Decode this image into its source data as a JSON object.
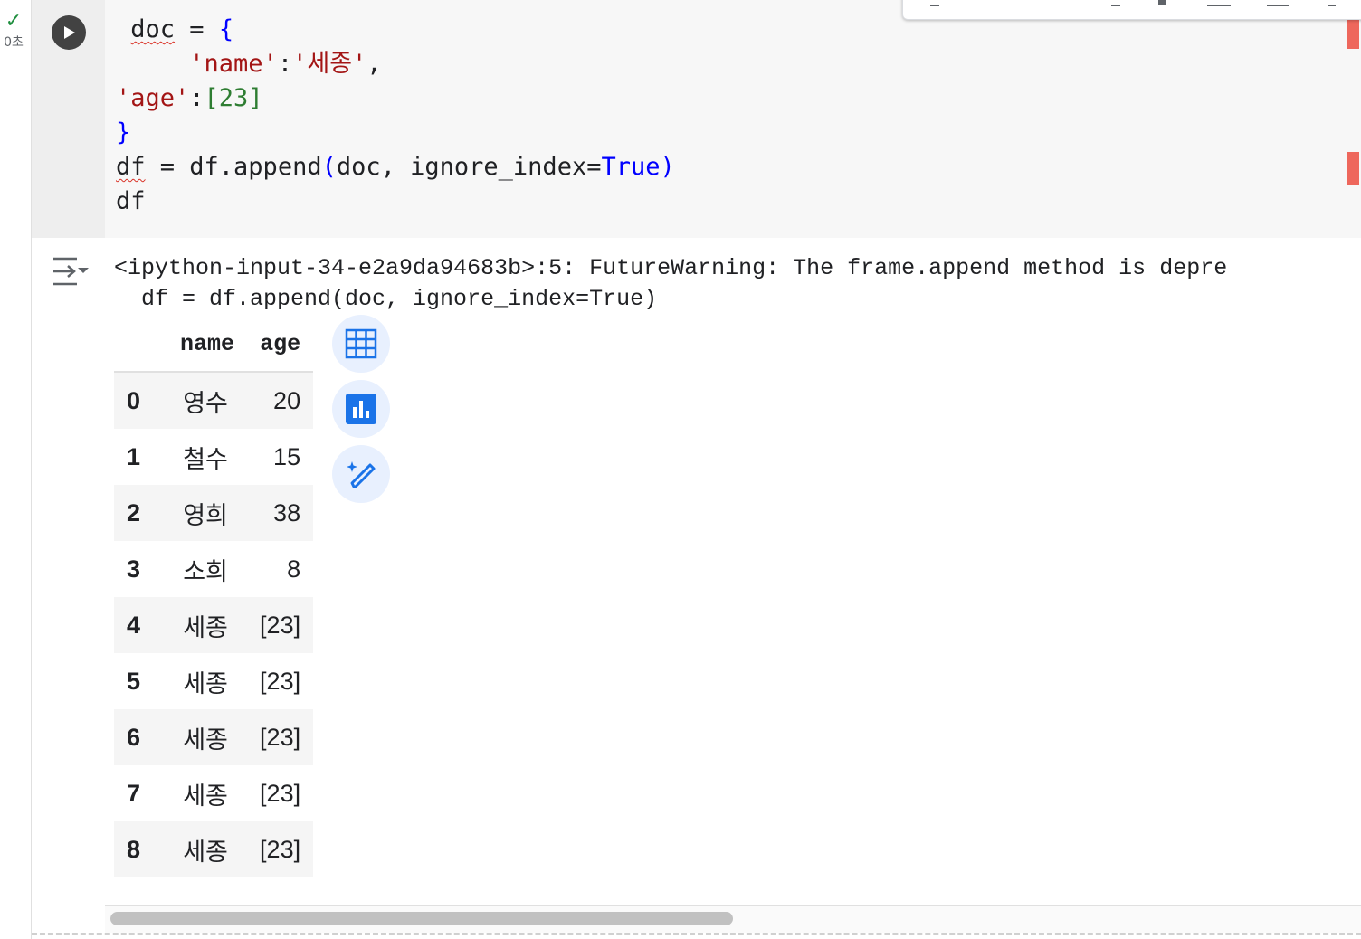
{
  "cell_status": {
    "check_symbol": "✓",
    "exec_time": "0초"
  },
  "code_lines": [
    [
      {
        "t": " ",
        "c": "plain"
      },
      {
        "t": "doc",
        "c": "squig"
      },
      {
        "t": " = ",
        "c": "plain"
      },
      {
        "t": "{",
        "c": "kw"
      }
    ],
    [
      {
        "t": "     ",
        "c": "plain"
      },
      {
        "t": "'name'",
        "c": "str"
      },
      {
        "t": ":",
        "c": "plain"
      },
      {
        "t": "'세종'",
        "c": "str"
      },
      {
        "t": ",",
        "c": "plain"
      }
    ],
    [
      {
        "t": "'age'",
        "c": "str"
      },
      {
        "t": ":",
        "c": "plain"
      },
      {
        "t": "[23]",
        "c": "num"
      }
    ],
    [
      {
        "t": "}",
        "c": "kw"
      }
    ],
    [
      {
        "t": "df",
        "c": "squig"
      },
      {
        "t": " = df.append",
        "c": "plain"
      },
      {
        "t": "(",
        "c": "kw"
      },
      {
        "t": "doc, ignore_index=",
        "c": "plain"
      },
      {
        "t": "True",
        "c": "kw"
      },
      {
        "t": ")",
        "c": "kw"
      }
    ],
    [
      {
        "t": "df",
        "c": "plain"
      }
    ]
  ],
  "output": {
    "warning_line1": "<ipython-input-34-e2a9da94683b>:5: FutureWarning: The frame.append method is depre",
    "warning_line2": "  df = df.append(doc, ignore_index=True)"
  },
  "dataframe": {
    "columns": [
      "name",
      "age"
    ],
    "rows": [
      {
        "index": "0",
        "name": "영수",
        "age": "20"
      },
      {
        "index": "1",
        "name": "철수",
        "age": "15"
      },
      {
        "index": "2",
        "name": "영희",
        "age": "38"
      },
      {
        "index": "3",
        "name": "소희",
        "age": "8"
      },
      {
        "index": "4",
        "name": "세종",
        "age": "[23]"
      },
      {
        "index": "5",
        "name": "세종",
        "age": "[23]"
      },
      {
        "index": "6",
        "name": "세종",
        "age": "[23]"
      },
      {
        "index": "7",
        "name": "세종",
        "age": "[23]"
      },
      {
        "index": "8",
        "name": "세종",
        "age": "[23]"
      }
    ]
  },
  "side_buttons": [
    "table-icon",
    "bar-chart-icon",
    "magic-pencil-icon"
  ],
  "colors": {
    "accent_blue": "#1a73e8",
    "error_marker": "#ee675c",
    "keyword": "#0000ff",
    "string": "#a31515",
    "number": "#2e7d32"
  }
}
